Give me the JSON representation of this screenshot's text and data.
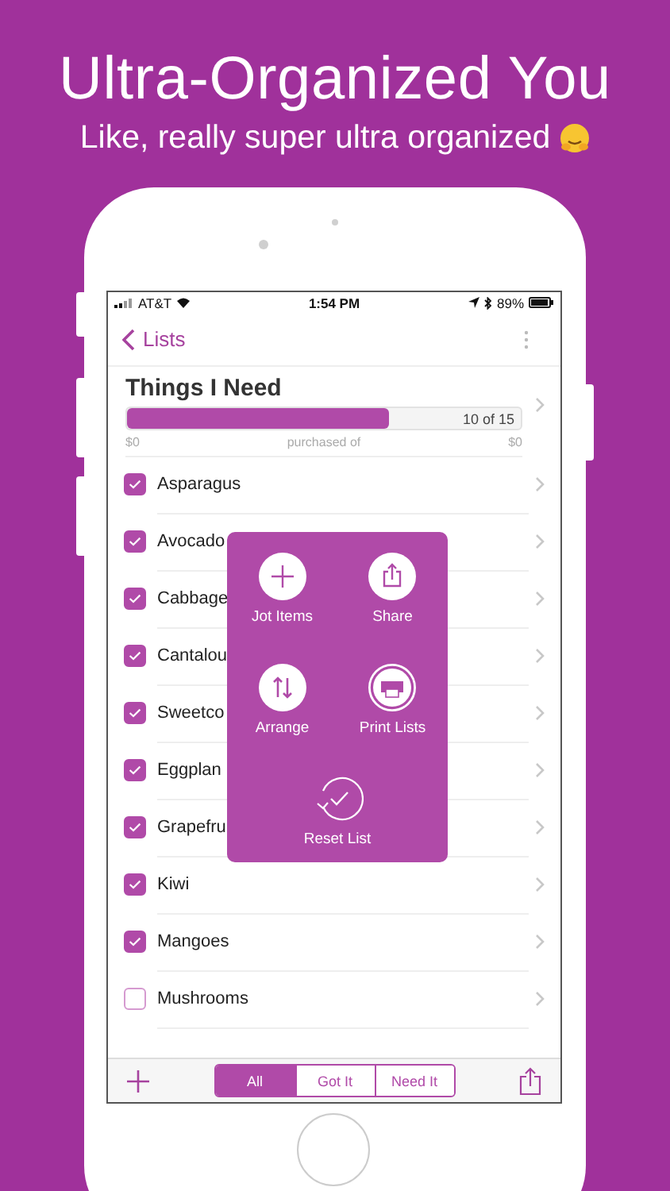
{
  "headline": {
    "title": "Ultra-Organized You",
    "subtitle": "Like, really super ultra organized"
  },
  "status_bar": {
    "carrier": "AT&T",
    "time": "1:54 PM",
    "battery": "89%"
  },
  "nav": {
    "back": "Lists"
  },
  "list": {
    "title": "Things I Need",
    "level": 0.667,
    "reading": "10 of 15",
    "spent": "$0",
    "caption": "purchased of",
    "total": "$0"
  },
  "items": [
    {
      "name": "Asparagus",
      "checked": true
    },
    {
      "name": "Avocado",
      "checked": true
    },
    {
      "name": "Cabbage",
      "checked": true
    },
    {
      "name": "Cantalou",
      "checked": true
    },
    {
      "name": "Sweetco",
      "checked": true
    },
    {
      "name": "Eggplan",
      "checked": true
    },
    {
      "name": "Grapefru",
      "checked": true
    },
    {
      "name": "Kiwi",
      "checked": true
    },
    {
      "name": "Mangoes",
      "checked": true
    },
    {
      "name": "Mushrooms",
      "checked": false
    }
  ],
  "menu": [
    {
      "label": "Jot Items",
      "kind": "add"
    },
    {
      "label": "Share",
      "kind": "share"
    },
    {
      "label": "Arrange",
      "kind": "arrange"
    },
    {
      "label": "Print Lists",
      "kind": "print"
    },
    {
      "label": "Reset List",
      "kind": "reset"
    }
  ],
  "filter": [
    {
      "label": "All",
      "selected": true
    },
    {
      "label": "Got It",
      "selected": false
    },
    {
      "label": "Need It",
      "selected": false
    }
  ]
}
